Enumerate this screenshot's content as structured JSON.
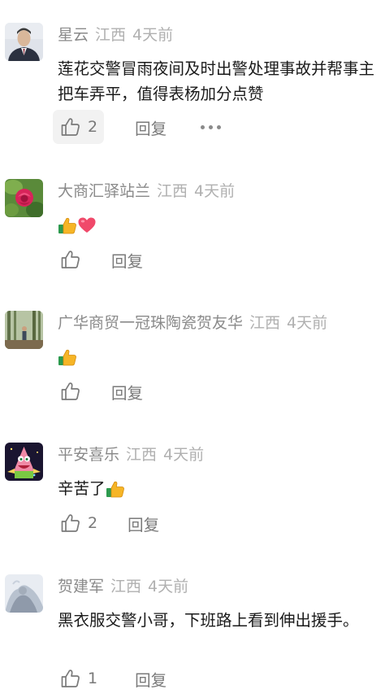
{
  "reply_label": "回复",
  "comments": [
    {
      "name": "星云",
      "region": "江西",
      "time": "4天前",
      "text": "莲花交警冒雨夜间及时出警处理事故并帮事主把车弄平，值得表杨加分点赞",
      "likes": "2"
    },
    {
      "name": "大商汇驿站兰",
      "region": "江西",
      "time": "4天前",
      "emojis": [
        "thumbs-up-emoji",
        "heart-emoji"
      ],
      "likes": ""
    },
    {
      "name": "广华商贸一冠珠陶瓷贺友华",
      "region": "江西",
      "time": "4天前",
      "emojis": [
        "thumbs-up-emoji"
      ],
      "likes": ""
    },
    {
      "name": "平安喜乐",
      "region": "江西",
      "time": "4天前",
      "text": "辛苦了",
      "emojis": [
        "thumbs-up-emoji"
      ],
      "likes": "2"
    },
    {
      "name": "贺建军",
      "region": "江西",
      "time": "4天前",
      "text": "黑衣服交警小哥，下班路上看到伸出援手。",
      "likes": "1"
    }
  ],
  "icons": {
    "like": "thumbs-up-outline-icon",
    "more": "more-dots-icon"
  },
  "colors": {
    "name": "#8a8a8a",
    "meta": "#b0b0b0",
    "action": "#7a7a7a",
    "active_bg": "#f2f2f2"
  }
}
